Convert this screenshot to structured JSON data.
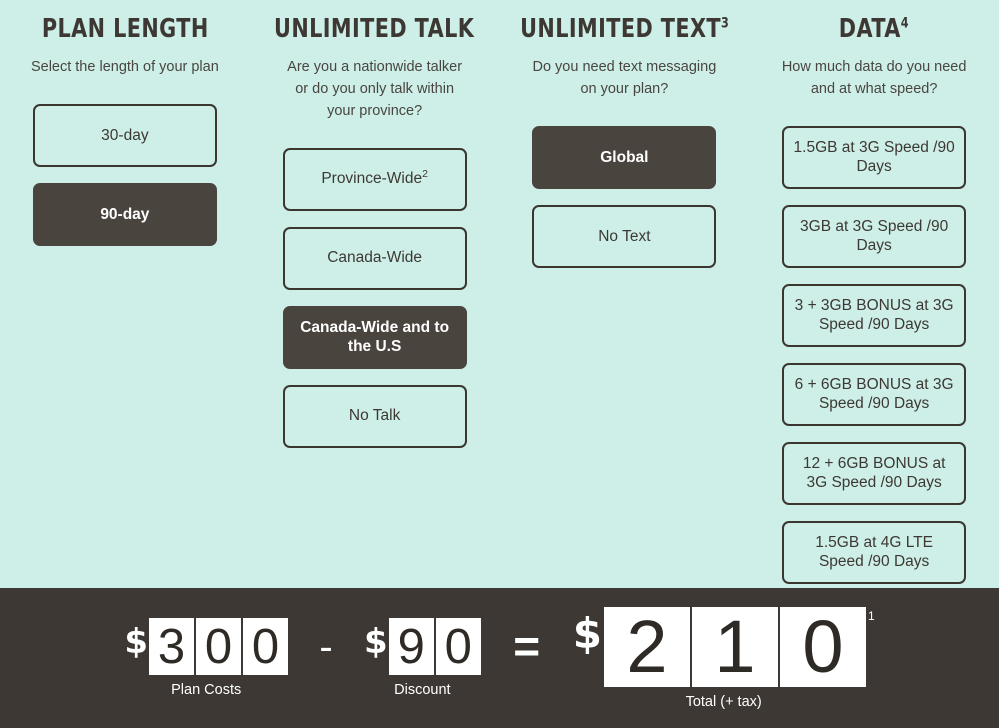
{
  "theme": {
    "background": "#cdefe8",
    "dark": "#3d3833",
    "selected_fill": "#4a443f",
    "border": "#3b3630",
    "digit_box": "#ffffff"
  },
  "columns": [
    {
      "id": "plan-length",
      "title": "PLAN LENGTH",
      "title_sup": "",
      "subtitle": "Select the length of your plan",
      "options": [
        {
          "label": "30-day",
          "sup": "",
          "selected": false
        },
        {
          "label": "90-day",
          "sup": "",
          "selected": true
        }
      ]
    },
    {
      "id": "unlimited-talk",
      "title": "UNLIMITED TALK",
      "title_sup": "",
      "subtitle": "Are you a nationwide talker or do you only talk within your province?",
      "options": [
        {
          "label": "Province-Wide",
          "sup": "2",
          "selected": false
        },
        {
          "label": "Canada-Wide",
          "sup": "",
          "selected": false
        },
        {
          "label": "Canada-Wide and to the U.S",
          "sup": "",
          "selected": true
        },
        {
          "label": "No Talk",
          "sup": "",
          "selected": false
        }
      ]
    },
    {
      "id": "unlimited-text",
      "title": "UNLIMITED TEXT",
      "title_sup": "3",
      "subtitle": "Do you need text messaging on your plan?",
      "options": [
        {
          "label": "Global",
          "sup": "",
          "selected": true
        },
        {
          "label": "No Text",
          "sup": "",
          "selected": false
        }
      ]
    },
    {
      "id": "data",
      "title": "DATA",
      "title_sup": "4",
      "subtitle": "How much data do you need and at what speed?",
      "options": [
        {
          "label": "1.5GB at 3G Speed /90 Days",
          "sup": "",
          "selected": false
        },
        {
          "label": "3GB at 3G Speed /90 Days",
          "sup": "",
          "selected": false
        },
        {
          "label": "3 + 3GB BONUS at 3G Speed /90 Days",
          "sup": "",
          "selected": false
        },
        {
          "label": "6 + 6GB BONUS at 3G Speed /90 Days",
          "sup": "",
          "selected": false
        },
        {
          "label": "12 + 6GB BONUS at 3G Speed /90 Days",
          "sup": "",
          "selected": false
        },
        {
          "label": "1.5GB at 4G LTE Speed /90 Days",
          "sup": "",
          "selected": false
        }
      ]
    }
  ],
  "pricebar": {
    "plan_cost": {
      "currency": "$",
      "digits": [
        "3",
        "0",
        "0"
      ],
      "caption": "Plan Costs"
    },
    "operator_minus": "-",
    "discount": {
      "currency": "$",
      "digits": [
        "9",
        "0"
      ],
      "caption": "Discount"
    },
    "operator_equals": "=",
    "total": {
      "currency": "$",
      "digits": [
        "2",
        "1",
        "0"
      ],
      "caption": "Total (+ tax)",
      "footnote": "1"
    }
  }
}
